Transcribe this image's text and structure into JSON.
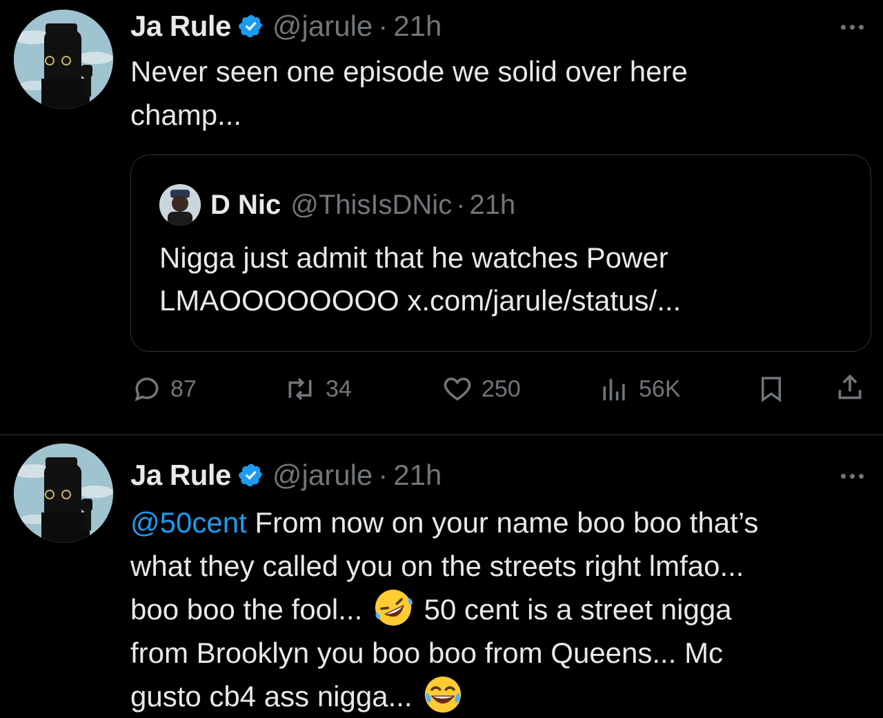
{
  "tweets": [
    {
      "author": {
        "name": "Ja Rule",
        "handle": "@jarule",
        "verified": true
      },
      "separator": "·",
      "time": "21h",
      "text": {
        "line1": "Never seen one episode we solid over here",
        "line2": "champ..."
      },
      "quote": {
        "author": {
          "name": "D Nic",
          "handle": "@ThisIsDNic"
        },
        "separator": "·",
        "time": "21h",
        "text_line1": "Nigga just admit that he watches Power",
        "text_line2_prefix": "LMAOOOOOOOO",
        "link": "x.com/jarule/status/..."
      },
      "actions": {
        "replies": "87",
        "reposts": "34",
        "likes": "250",
        "views": "56K"
      }
    },
    {
      "author": {
        "name": "Ja Rule",
        "handle": "@jarule",
        "verified": true
      },
      "separator": "·",
      "time": "21h",
      "mention": "@50cent",
      "text": {
        "l1": "From now on your name boo boo that’s",
        "l2": "what they called you on the streets right lmfao...",
        "l3a": "boo boo the fool...",
        "l3b": "50 cent is a street nigga",
        "l4": "from Brooklyn you boo boo from Queens... Mc",
        "l5": "gusto cb4 ass nigga..."
      },
      "emojis": [
        "rolling-on-floor-laughing-emoji",
        "tears-of-joy-emoji"
      ]
    }
  ],
  "colors": {
    "background": "#000000",
    "text": "#e7e9ea",
    "muted": "#71767b",
    "accent": "#1d9bf0",
    "border": "#2f3336"
  }
}
